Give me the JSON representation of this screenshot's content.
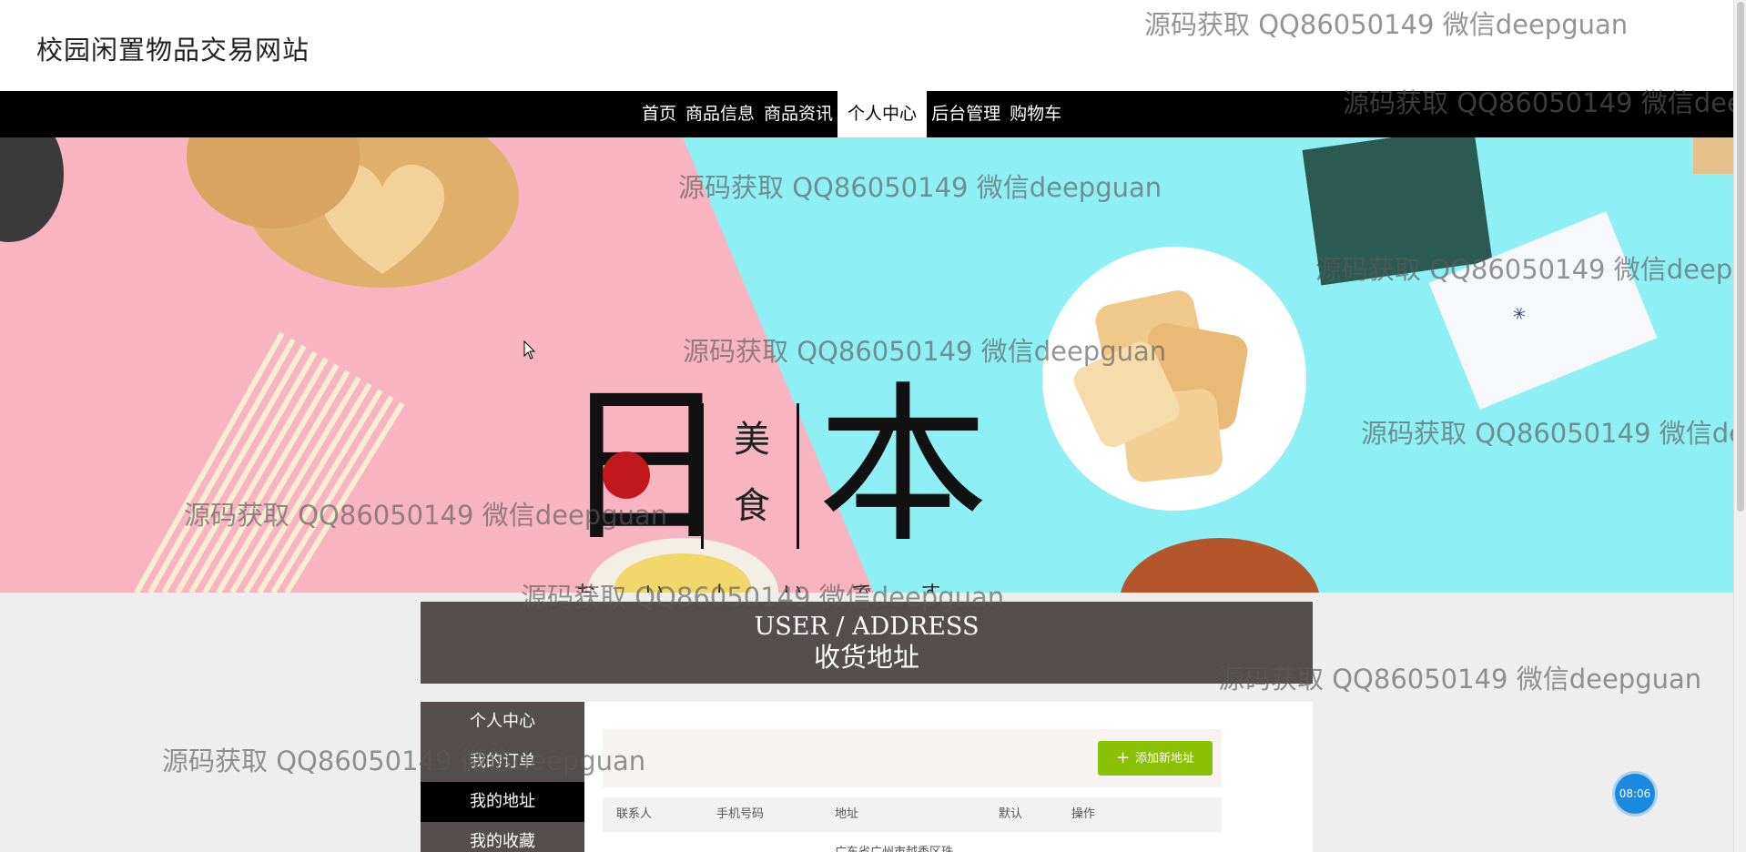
{
  "site": {
    "title": "校园闲置物品交易网站"
  },
  "nav": {
    "items": [
      "首页",
      "商品信息",
      "商品资讯",
      "个人中心",
      "后台管理",
      "购物车"
    ],
    "active_index": 3
  },
  "banner": {
    "logo": {
      "big1": "日",
      "mid1": "美",
      "mid2": "食",
      "big2": "本",
      "kana": "おいしいです"
    },
    "colors": {
      "left": "#f8b4c0",
      "right": "#8ef0f5",
      "dot": "#c0181b"
    }
  },
  "section": {
    "title_en": "USER / ADDRESS",
    "title_cn": "收货地址"
  },
  "sidebar": {
    "items": [
      {
        "label": "个人中心"
      },
      {
        "label": "我的订单"
      },
      {
        "label": "我的地址"
      },
      {
        "label": "我的收藏"
      }
    ],
    "active_index": 2
  },
  "address": {
    "add_button": "添加新地址",
    "columns": [
      "联系人",
      "手机号码",
      "地址",
      "默认",
      "操作"
    ],
    "rows": [
      {
        "address": "广东省广州市越秀区珠"
      }
    ]
  },
  "clock": {
    "time": "08:06"
  },
  "watermark": {
    "text": "源码获取 QQ86050149 微信deepguan"
  }
}
